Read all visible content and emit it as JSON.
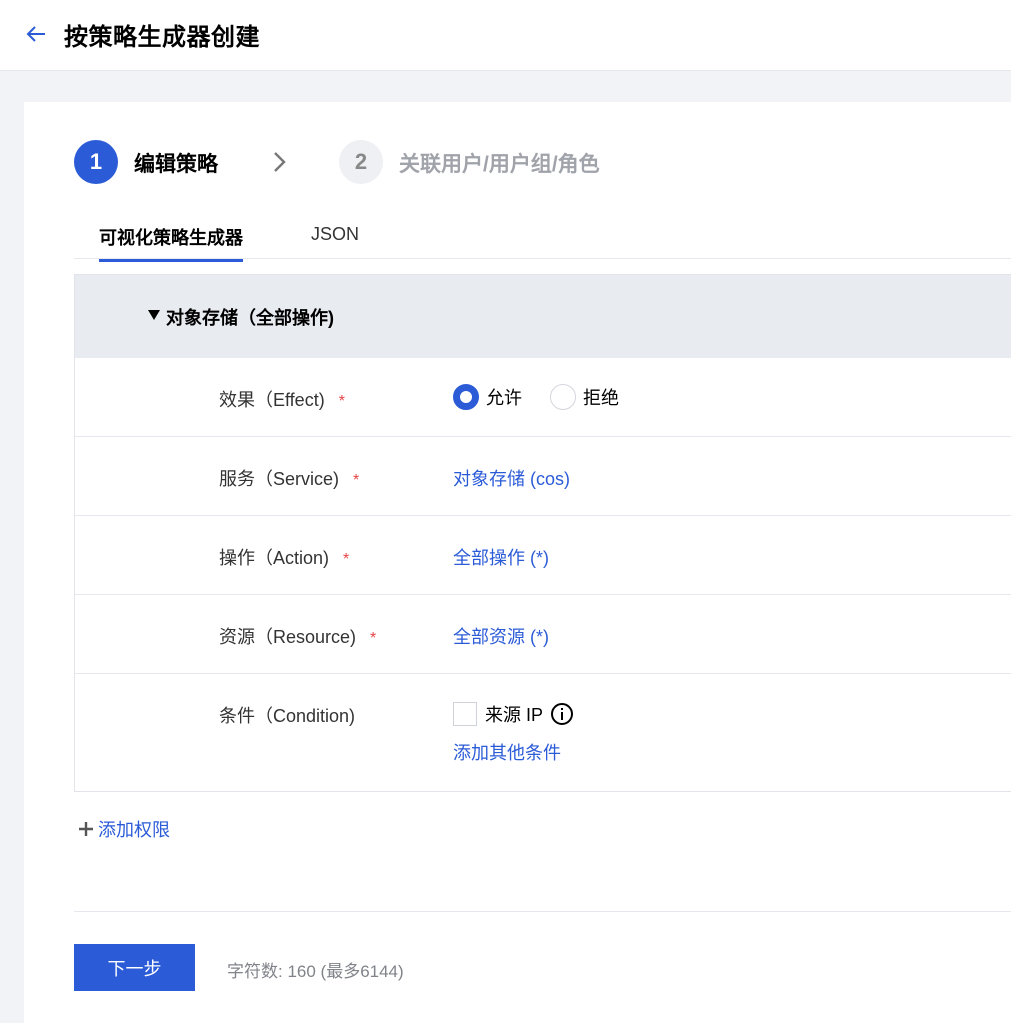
{
  "header": {
    "title": "按策略生成器创建",
    "back_icon": "arrow-left-icon"
  },
  "steps": [
    {
      "number": "1",
      "label": "编辑策略",
      "active": true
    },
    {
      "number": "2",
      "label": "关联用户/用户组/角色",
      "active": false
    }
  ],
  "tabs": [
    {
      "label": "可视化策略生成器",
      "active": true
    },
    {
      "label": "JSON",
      "active": false
    }
  ],
  "policy": {
    "section_title": "对象存储（全部操作)",
    "rows": {
      "effect": {
        "label": "效果（Effect)",
        "required": "*",
        "options": [
          "允许",
          "拒绝"
        ],
        "selected": "允许"
      },
      "service": {
        "label": "服务（Service)",
        "required": "*",
        "value": "对象存储 (cos)"
      },
      "action": {
        "label": "操作（Action)",
        "required": "*",
        "value": "全部操作 (*)"
      },
      "resource": {
        "label": "资源（Resource)",
        "required": "*",
        "value": "全部资源 (*)"
      },
      "condition": {
        "label": "条件（Condition)",
        "checkbox_label": "来源 IP",
        "checked": false,
        "add_label": "添加其他条件"
      }
    }
  },
  "add_permission": "添加权限",
  "footer": {
    "next_label": "下一步",
    "char_count": "字符数: 160 (最多6144)"
  },
  "colors": {
    "primary": "#2b5bd7",
    "required": "#e54545",
    "panel_header_bg": "#e8ebf0"
  }
}
